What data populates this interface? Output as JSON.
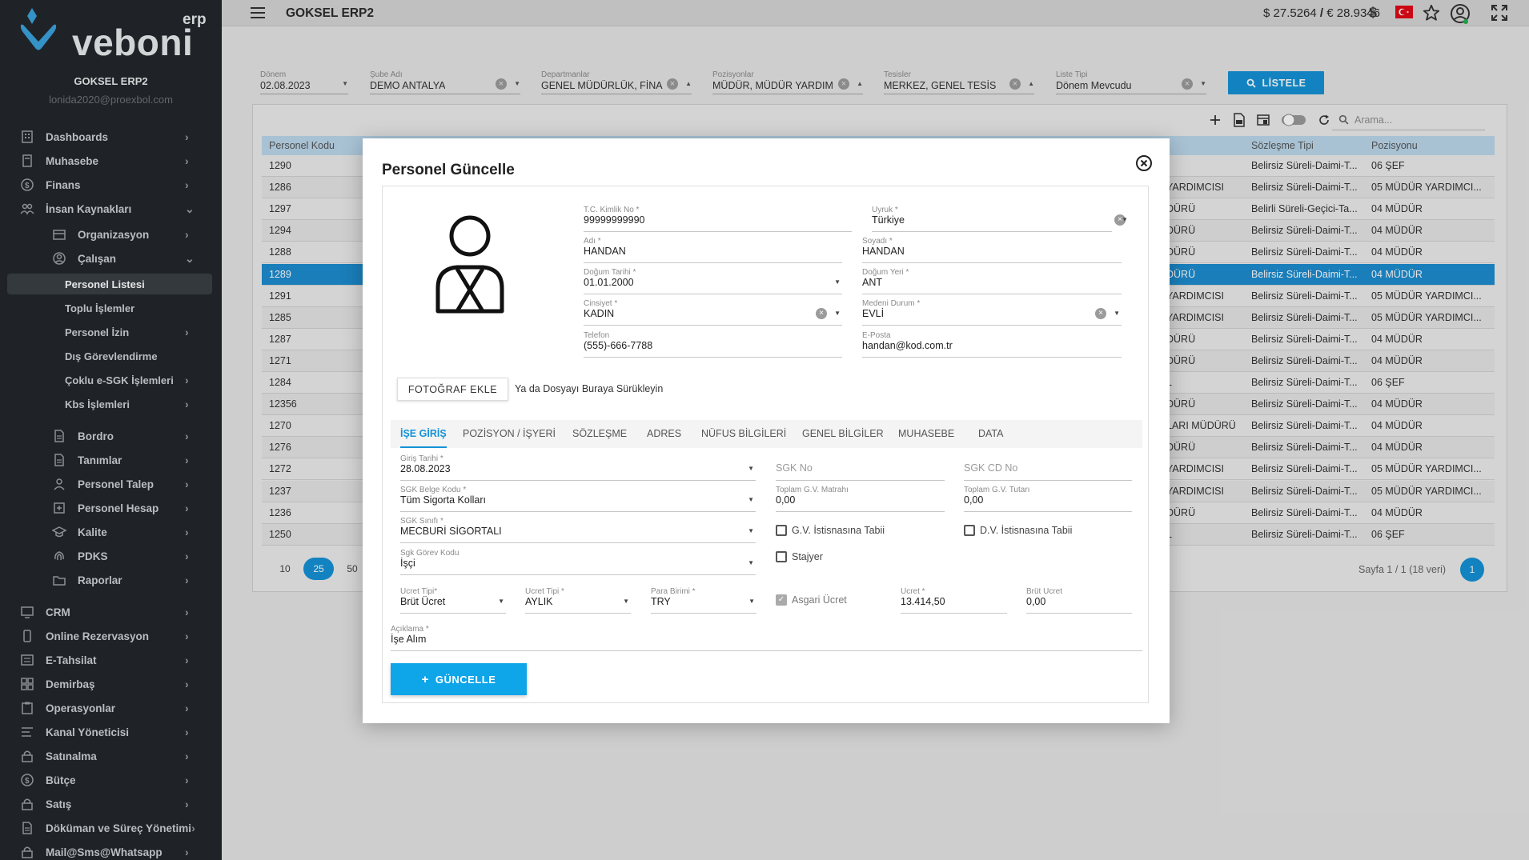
{
  "app": {
    "logo_text": "veboni",
    "logo_sup": "erp",
    "company": "GOKSEL ERP2",
    "email": "lonida2020@proexbol.com"
  },
  "sidebar": {
    "items": [
      {
        "label": "Dashboards",
        "icon": "building-icon"
      },
      {
        "label": "Muhasebe",
        "icon": "calculator-icon"
      },
      {
        "label": "Finans",
        "icon": "dollar-circle-icon"
      },
      {
        "label": "İnsan Kaynakları",
        "icon": "people-icon"
      },
      {
        "label": "Organizasyon",
        "icon": "org-icon"
      },
      {
        "label": "Çalışan",
        "icon": "user-circle-icon"
      },
      {
        "label": "Personel Listesi"
      },
      {
        "label": "Toplu İşlemler"
      },
      {
        "label": "Personel İzin"
      },
      {
        "label": "Dış Görevlendirme"
      },
      {
        "label": "Çoklu e-SGK İşlemleri"
      },
      {
        "label": "Kbs İşlemleri"
      },
      {
        "label": "Bordro",
        "icon": "document-icon"
      },
      {
        "label": "Tanımlar",
        "icon": "document-icon"
      },
      {
        "label": "Personel Talep",
        "icon": "user-icon"
      },
      {
        "label": "Personel Hesap",
        "icon": "account-icon"
      },
      {
        "label": "Kalite",
        "icon": "graduation-icon"
      },
      {
        "label": "PDKS",
        "icon": "fingerprint-icon"
      },
      {
        "label": "Raporlar",
        "icon": "folder-icon"
      },
      {
        "label": "CRM",
        "icon": "monitor-icon"
      },
      {
        "label": "Online Rezervasyon",
        "icon": "phone-icon"
      },
      {
        "label": "E-Tahsilat",
        "icon": "card-icon"
      },
      {
        "label": "Demirbaş",
        "icon": "grid-icon"
      },
      {
        "label": "Operasyonlar",
        "icon": "clipboard-icon"
      },
      {
        "label": "Kanal Yöneticisi",
        "icon": "list-icon"
      },
      {
        "label": "Satınalma",
        "icon": "lock-icon"
      },
      {
        "label": "Bütçe",
        "icon": "dollar-circle-icon"
      },
      {
        "label": "Satış",
        "icon": "lock-icon"
      },
      {
        "label": "Döküman ve Süreç Yönetimi",
        "icon": "document-icon"
      },
      {
        "label": "Mail@Sms@Whatsapp",
        "icon": "lock-icon"
      }
    ]
  },
  "topbar": {
    "title": "GOKSEL ERP2",
    "rate_usd": "$ 27.5264",
    "rate_sep": "/",
    "rate_eur": "€ 28.9346"
  },
  "filters": [
    {
      "label": "Dönem",
      "value": "02.08.2023"
    },
    {
      "label": "Şube Adı",
      "value": "DEMO ANTALYA"
    },
    {
      "label": "Departmanlar",
      "value": "GENEL MÜDÜRLÜK, FİNA..."
    },
    {
      "label": "Pozisyonlar",
      "value": "MÜDÜR, MÜDÜR YARDIM..."
    },
    {
      "label": "Tesisler",
      "value": "MERKEZ, GENEL TESİS"
    },
    {
      "label": "Liste Tipi",
      "value": "Dönem Mevcudu"
    }
  ],
  "listele_label": "LİSTELE",
  "search_placeholder": "Arama...",
  "table": {
    "headers": [
      "Personel Kodu",
      "Sözleşme Tipi",
      "Pozisyonu"
    ],
    "rows": [
      {
        "code": "1290",
        "mid": "",
        "contract": "Belirsiz Süreli-Daimi-T...",
        "position": "06 ŞEF"
      },
      {
        "code": "1286",
        "mid": "YARDIMCISI",
        "contract": "Belirsiz Süreli-Daimi-T...",
        "position": "05 MÜDÜR YARDIMCI..."
      },
      {
        "code": "1297",
        "mid": "DÜRÜ",
        "contract": "Belirli Süreli-Geçici-Ta...",
        "position": "04 MÜDÜR"
      },
      {
        "code": "1294",
        "mid": "DÜRÜ",
        "contract": "Belirsiz Süreli-Daimi-T...",
        "position": "04 MÜDÜR"
      },
      {
        "code": "1288",
        "mid": "DÜRÜ",
        "contract": "Belirsiz Süreli-Daimi-T...",
        "position": "04 MÜDÜR"
      },
      {
        "code": "1289",
        "mid": "DÜRÜ",
        "contract": "Belirsiz Süreli-Daimi-T...",
        "position": "04 MÜDÜR"
      },
      {
        "code": "1291",
        "mid": "YARDIMCISI",
        "contract": "Belirsiz Süreli-Daimi-T...",
        "position": "05 MÜDÜR YARDIMCI..."
      },
      {
        "code": "1285",
        "mid": "YARDIMCISI",
        "contract": "Belirsiz Süreli-Daimi-T...",
        "position": "05 MÜDÜR YARDIMCI..."
      },
      {
        "code": "1287",
        "mid": "DÜRÜ",
        "contract": "Belirsiz Süreli-Daimi-T...",
        "position": "04 MÜDÜR"
      },
      {
        "code": "1271",
        "mid": "DÜRÜ",
        "contract": "Belirsiz Süreli-Daimi-T...",
        "position": "04 MÜDÜR"
      },
      {
        "code": "1284",
        "mid": "L",
        "contract": "Belirsiz Süreli-Daimi-T...",
        "position": "06 ŞEF"
      },
      {
        "code": "12356",
        "mid": "DÜRÜ",
        "contract": "Belirsiz Süreli-Daimi-T...",
        "position": "04 MÜDÜR"
      },
      {
        "code": "1270",
        "mid": "LARI MÜDÜRÜ",
        "contract": "Belirsiz Süreli-Daimi-T...",
        "position": "04 MÜDÜR"
      },
      {
        "code": "1276",
        "mid": "DÜRÜ",
        "contract": "Belirsiz Süreli-Daimi-T...",
        "position": "04 MÜDÜR"
      },
      {
        "code": "1272",
        "mid": "YARDIMCISI",
        "contract": "Belirsiz Süreli-Daimi-T...",
        "position": "05 MÜDÜR YARDIMCI..."
      },
      {
        "code": "1237",
        "mid": "YARDIMCISI",
        "contract": "Belirsiz Süreli-Daimi-T...",
        "position": "05 MÜDÜR YARDIMCI..."
      },
      {
        "code": "1236",
        "mid": "DÜRÜ",
        "contract": "Belirsiz Süreli-Daimi-T...",
        "position": "04 MÜDÜR"
      },
      {
        "code": "1250",
        "mid": "L",
        "contract": "Belirsiz Süreli-Daimi-T...",
        "position": "06 ŞEF"
      }
    ],
    "selected_code": "1289"
  },
  "pager": {
    "sizes": [
      "10",
      "25",
      "50"
    ],
    "active_size": "25",
    "info": "Sayfa 1 / 1 (18 veri)",
    "page": "1"
  },
  "modal": {
    "title": "Personel Güncelle",
    "fields": {
      "tc": {
        "label": "T.C. Kimlik No *",
        "value": "99999999990"
      },
      "uyruk": {
        "label": "Uyruk *",
        "value": "Türkiye"
      },
      "adi": {
        "label": "Adı *",
        "value": "HANDAN"
      },
      "soyadi": {
        "label": "Soyadı *",
        "value": "HANDAN"
      },
      "dogum_tarihi": {
        "label": "Doğum Tarihi *",
        "value": "01.01.2000"
      },
      "dogum_yeri": {
        "label": "Doğum Yeri *",
        "value": "ANT"
      },
      "cinsiyet": {
        "label": "Cinsiyet *",
        "value": "KADIN"
      },
      "medeni": {
        "label": "Medeni Durum *",
        "value": "EVLİ"
      },
      "telefon": {
        "label": "Telefon",
        "value": "(555)-666-7788"
      },
      "eposta": {
        "label": "E-Posta",
        "value": "handan@kod.com.tr"
      }
    },
    "photo_button": "FOTOĞRAF EKLE",
    "drop_text": "Ya da Dosyayı Buraya Sürükleyin",
    "tabs": [
      "İŞE GİRİŞ",
      "POZİSYON / İŞYERİ",
      "SÖZLEŞME",
      "ADRES",
      "NÜFUS BİLGİLERİ",
      "GENEL BİLGİLER",
      "MUHASEBE",
      "DATA"
    ],
    "active_tab": "İŞE GİRİŞ",
    "ise_giris": {
      "giris_tarihi": {
        "label": "Giriş Tarihi *",
        "value": "28.08.2023"
      },
      "sgk_no": {
        "placeholder": "SGK No"
      },
      "sgk_cd_no": {
        "placeholder": "SGK CD No"
      },
      "sgk_belge": {
        "label": "SGK Belge Kodu *",
        "value": "Tüm Sigorta Kolları"
      },
      "gv_matrahi": {
        "label": "Toplam G.V. Matrahı",
        "value": "0,00"
      },
      "gv_tutari": {
        "label": "Toplam G.V. Tutarı",
        "value": "0,00"
      },
      "sgk_sinifi": {
        "label": "SGK Sınıfı *",
        "value": "MECBURİ SİGORTALI"
      },
      "gv_istisna": "G.V. İstisnasına Tabii",
      "dv_istisna": "D.V. İstisnasına Tabii",
      "sgk_gorev": {
        "label": "Sgk Görev Kodu",
        "value": "İşçi"
      },
      "stajyer": "Stajyer",
      "ucret_tipi1": {
        "label": "Ucret Tipi*",
        "value": "Brüt Ücret"
      },
      "ucret_tipi2": {
        "label": "Ucret Tipi *",
        "value": "AYLIK"
      },
      "para_birimi": {
        "label": "Para Birimi *",
        "value": "TRY"
      },
      "asgari": "Asgari Ücret",
      "ucret": {
        "label": "Ucret *",
        "value": "13.414,50"
      },
      "brut_ucret": {
        "label": "Brüt Ucret",
        "value": "0,00"
      },
      "aciklama": {
        "label": "Açıklama *",
        "value": "İşe Alım"
      }
    },
    "submit_label": "GÜNCELLE"
  },
  "colors": {
    "sidebar_bg": "#23282c",
    "accent": "#1592d6",
    "selected_row": "#1d8dd0",
    "header_row": "#bcd9ec",
    "logo_blue": "#3aa3dd"
  }
}
